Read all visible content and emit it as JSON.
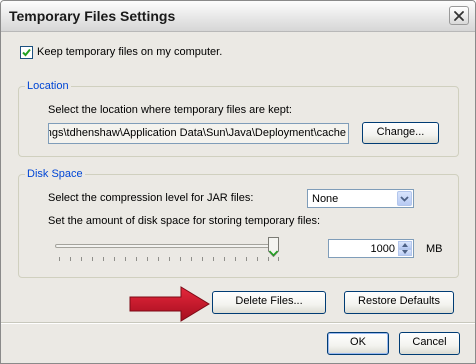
{
  "window": {
    "title": "Temporary Files Settings"
  },
  "keep_files": {
    "label": "Keep temporary files on my computer.",
    "checked": true
  },
  "location": {
    "legend": "Location",
    "description": "Select the location where temporary files are kept:",
    "path": "C:\\Documents and Settings\\tdhenshaw\\Application Data\\Sun\\Java\\Deployment\\cache",
    "change_label": "Change..."
  },
  "disk_space": {
    "legend": "Disk Space",
    "compression_label": "Select the compression level for JAR files:",
    "compression_value": "None",
    "amount_label": "Set the amount of disk space for storing temporary files:",
    "amount_value": "1000",
    "unit": "MB"
  },
  "actions": {
    "delete_label": "Delete Files...",
    "restore_label": "Restore Defaults"
  },
  "footer": {
    "ok_label": "OK",
    "cancel_label": "Cancel"
  },
  "colors": {
    "legend": "#0046d5",
    "arrow": "#c8102e"
  },
  "icons": {
    "close": "close-icon",
    "checkmark": "checkmark-icon",
    "dropdown": "chevron-down-icon",
    "annotation": "arrow-right-icon"
  }
}
